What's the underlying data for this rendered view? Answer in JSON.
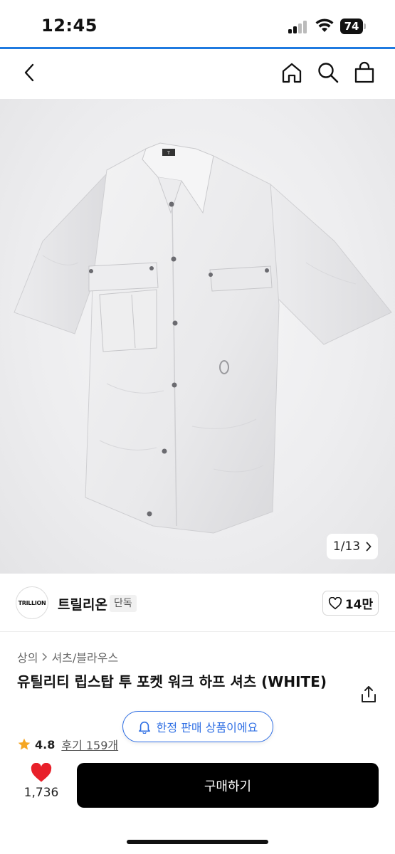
{
  "status_bar": {
    "time": "12:45",
    "battery": "74"
  },
  "colors": {
    "accent_line": "#1f7ae0",
    "wish_heart": "#e8202a",
    "limited": "#2f6fe4",
    "buy_button": "#000000"
  },
  "nav": {
    "icons": [
      "back-icon",
      "home-icon",
      "search-icon",
      "bag-icon"
    ]
  },
  "gallery": {
    "counter": "1/13",
    "logo_text": "T"
  },
  "brand": {
    "logo": "TRILLION",
    "name": "트릴리온",
    "badge": "단독",
    "likes": "14만"
  },
  "product": {
    "breadcrumb": [
      "상의",
      "셔츠/블라우스"
    ],
    "title": "유틸리티 립스탑 투 포켓 워크 하프 셔츠 (WHITE)",
    "rating": "4.8",
    "reviews": "후기 159개",
    "limited_label": "한정 판매 상품이에요"
  },
  "bottom": {
    "wish_count": "1,736",
    "buy_label": "구매하기"
  }
}
